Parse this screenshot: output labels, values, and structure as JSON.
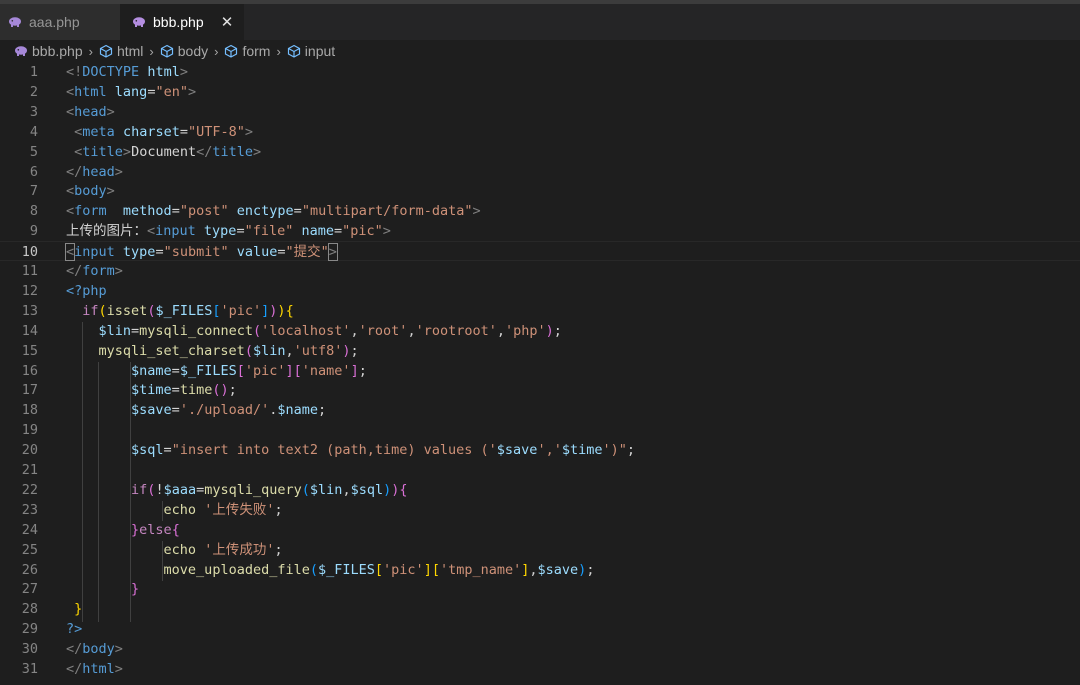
{
  "tabs": [
    {
      "label": "aaa.php",
      "active": false
    },
    {
      "label": "bbb.php",
      "active": true
    }
  ],
  "tab_close_glyph": "✕",
  "breadcrumb": {
    "file": "bbb.php",
    "items": [
      "html",
      "body",
      "form",
      "input"
    ],
    "separator": "›"
  },
  "editor": {
    "current_line": 10,
    "line_numbers": [
      "1",
      "2",
      "3",
      "4",
      "5",
      "6",
      "7",
      "8",
      "9",
      "10",
      "11",
      "12",
      "13",
      "14",
      "15",
      "16",
      "17",
      "18",
      "19",
      "20",
      "21",
      "22",
      "23",
      "24",
      "25",
      "26",
      "27",
      "28",
      "29",
      "30",
      "31"
    ],
    "lines": [
      [
        [
          "t-tag",
          "<!"
        ],
        [
          "t-doct",
          "DOCTYPE"
        ],
        [
          "t-text",
          " "
        ],
        [
          "t-attr",
          "html"
        ],
        [
          "t-tag",
          ">"
        ]
      ],
      [
        [
          "t-tag",
          "<"
        ],
        [
          "t-name",
          "html"
        ],
        [
          "t-text",
          " "
        ],
        [
          "t-attr",
          "lang"
        ],
        [
          "t-text",
          "="
        ],
        [
          "t-str",
          "\"en\""
        ],
        [
          "t-tag",
          ">"
        ]
      ],
      [
        [
          "t-tag",
          "<"
        ],
        [
          "t-name",
          "head"
        ],
        [
          "t-tag",
          ">"
        ]
      ],
      [
        [
          "t-text",
          " "
        ],
        [
          "t-tag",
          "<"
        ],
        [
          "t-name",
          "meta"
        ],
        [
          "t-text",
          " "
        ],
        [
          "t-attr",
          "charset"
        ],
        [
          "t-text",
          "="
        ],
        [
          "t-str",
          "\"UTF-8\""
        ],
        [
          "t-tag",
          ">"
        ]
      ],
      [
        [
          "t-text",
          " "
        ],
        [
          "t-tag",
          "<"
        ],
        [
          "t-name",
          "title"
        ],
        [
          "t-tag",
          ">"
        ],
        [
          "t-text",
          "Document"
        ],
        [
          "t-tag",
          "</"
        ],
        [
          "t-name",
          "title"
        ],
        [
          "t-tag",
          ">"
        ]
      ],
      [
        [
          "t-tag",
          "</"
        ],
        [
          "t-name",
          "head"
        ],
        [
          "t-tag",
          ">"
        ]
      ],
      [
        [
          "t-tag",
          "<"
        ],
        [
          "t-name",
          "body"
        ],
        [
          "t-tag",
          ">"
        ]
      ],
      [
        [
          "t-tag",
          "<"
        ],
        [
          "t-name",
          "form"
        ],
        [
          "t-text",
          "  "
        ],
        [
          "t-attr",
          "method"
        ],
        [
          "t-text",
          "="
        ],
        [
          "t-str",
          "\"post\""
        ],
        [
          "t-text",
          " "
        ],
        [
          "t-attr",
          "enctype"
        ],
        [
          "t-text",
          "="
        ],
        [
          "t-str",
          "\"multipart/form-data\""
        ],
        [
          "t-tag",
          ">"
        ]
      ],
      [
        [
          "t-text",
          "上传的图片："
        ],
        [
          "t-tag",
          "<"
        ],
        [
          "t-name",
          "input"
        ],
        [
          "t-text",
          " "
        ],
        [
          "t-attr",
          "type"
        ],
        [
          "t-text",
          "="
        ],
        [
          "t-str",
          "\"file\""
        ],
        [
          "t-text",
          " "
        ],
        [
          "t-attr",
          "name"
        ],
        [
          "t-text",
          "="
        ],
        [
          "t-str",
          "\"pic\""
        ],
        [
          "t-tag",
          ">"
        ]
      ],
      [
        [
          "t-tag cursor-box",
          "<"
        ],
        [
          "t-name",
          "input"
        ],
        [
          "t-text",
          " "
        ],
        [
          "t-attr",
          "type"
        ],
        [
          "t-text",
          "="
        ],
        [
          "t-str",
          "\"submit\""
        ],
        [
          "t-text",
          " "
        ],
        [
          "t-attr",
          "value"
        ],
        [
          "t-text",
          "="
        ],
        [
          "t-str",
          "\"提交\""
        ],
        [
          "t-tag cursor-box",
          ">"
        ]
      ],
      [
        [
          "t-tag",
          "</"
        ],
        [
          "t-name",
          "form"
        ],
        [
          "t-tag",
          ">"
        ]
      ],
      [
        [
          "t-php",
          "<?php"
        ]
      ],
      [
        [
          "t-text",
          "  "
        ],
        [
          "t-kw",
          "if"
        ],
        [
          "t-br1",
          "("
        ],
        [
          "t-fn",
          "isset"
        ],
        [
          "t-br2",
          "("
        ],
        [
          "t-var",
          "$_FILES"
        ],
        [
          "t-br3",
          "["
        ],
        [
          "t-str",
          "'pic'"
        ],
        [
          "t-br3",
          "]"
        ],
        [
          "t-br2",
          ")"
        ],
        [
          "t-br1",
          ")"
        ],
        [
          "t-br1",
          "{"
        ]
      ],
      [
        [
          "t-text",
          "    "
        ],
        [
          "t-var",
          "$lin"
        ],
        [
          "t-punc",
          "="
        ],
        [
          "t-fn",
          "mysqli_connect"
        ],
        [
          "t-br2",
          "("
        ],
        [
          "t-str",
          "'localhost'"
        ],
        [
          "t-punc",
          ","
        ],
        [
          "t-str",
          "'root'"
        ],
        [
          "t-punc",
          ","
        ],
        [
          "t-str",
          "'rootroot'"
        ],
        [
          "t-punc",
          ","
        ],
        [
          "t-str",
          "'php'"
        ],
        [
          "t-br2",
          ")"
        ],
        [
          "t-punc",
          ";"
        ]
      ],
      [
        [
          "t-text",
          "    "
        ],
        [
          "t-fn",
          "mysqli_set_charset"
        ],
        [
          "t-br2",
          "("
        ],
        [
          "t-var",
          "$lin"
        ],
        [
          "t-punc",
          ","
        ],
        [
          "t-str",
          "'utf8'"
        ],
        [
          "t-br2",
          ")"
        ],
        [
          "t-punc",
          ";"
        ]
      ],
      [
        [
          "t-text",
          "        "
        ],
        [
          "t-var",
          "$name"
        ],
        [
          "t-punc",
          "="
        ],
        [
          "t-var",
          "$_FILES"
        ],
        [
          "t-br2",
          "["
        ],
        [
          "t-str",
          "'pic'"
        ],
        [
          "t-br2",
          "]"
        ],
        [
          "t-br2",
          "["
        ],
        [
          "t-str",
          "'name'"
        ],
        [
          "t-br2",
          "]"
        ],
        [
          "t-punc",
          ";"
        ]
      ],
      [
        [
          "t-text",
          "        "
        ],
        [
          "t-var",
          "$time"
        ],
        [
          "t-punc",
          "="
        ],
        [
          "t-fn",
          "time"
        ],
        [
          "t-br2",
          "()"
        ],
        [
          "t-punc",
          ";"
        ]
      ],
      [
        [
          "t-text",
          "        "
        ],
        [
          "t-var",
          "$save"
        ],
        [
          "t-punc",
          "="
        ],
        [
          "t-str",
          "'./upload/'"
        ],
        [
          "t-punc",
          "."
        ],
        [
          "t-var",
          "$name"
        ],
        [
          "t-punc",
          ";"
        ]
      ],
      [],
      [
        [
          "t-text",
          "        "
        ],
        [
          "t-var",
          "$sql"
        ],
        [
          "t-punc",
          "="
        ],
        [
          "t-str",
          "\"insert into text2 (path,time) values ('"
        ],
        [
          "t-var",
          "$save"
        ],
        [
          "t-str",
          "','"
        ],
        [
          "t-var",
          "$time"
        ],
        [
          "t-str",
          "')\""
        ],
        [
          "t-punc",
          ";"
        ]
      ],
      [],
      [
        [
          "t-text",
          "        "
        ],
        [
          "t-kw",
          "if"
        ],
        [
          "t-br2",
          "("
        ],
        [
          "t-punc",
          "!"
        ],
        [
          "t-var",
          "$aaa"
        ],
        [
          "t-punc",
          "="
        ],
        [
          "t-fn",
          "mysqli_query"
        ],
        [
          "t-br3",
          "("
        ],
        [
          "t-var",
          "$lin"
        ],
        [
          "t-punc",
          ","
        ],
        [
          "t-var",
          "$sql"
        ],
        [
          "t-br3",
          ")"
        ],
        [
          "t-br2",
          ")"
        ],
        [
          "t-br2",
          "{"
        ]
      ],
      [
        [
          "t-text",
          "            "
        ],
        [
          "t-fn",
          "echo"
        ],
        [
          "t-text",
          " "
        ],
        [
          "t-str",
          "'上传失败'"
        ],
        [
          "t-punc",
          ";"
        ]
      ],
      [
        [
          "t-text",
          "        "
        ],
        [
          "t-br2",
          "}"
        ],
        [
          "t-kw",
          "else"
        ],
        [
          "t-br2",
          "{"
        ]
      ],
      [
        [
          "t-text",
          "            "
        ],
        [
          "t-fn",
          "echo"
        ],
        [
          "t-text",
          " "
        ],
        [
          "t-str",
          "'上传成功'"
        ],
        [
          "t-punc",
          ";"
        ]
      ],
      [
        [
          "t-text",
          "            "
        ],
        [
          "t-fn",
          "move_uploaded_file"
        ],
        [
          "t-br3",
          "("
        ],
        [
          "t-var",
          "$_FILES"
        ],
        [
          "t-br1",
          "["
        ],
        [
          "t-str",
          "'pic'"
        ],
        [
          "t-br1",
          "]"
        ],
        [
          "t-br1",
          "["
        ],
        [
          "t-str",
          "'tmp_name'"
        ],
        [
          "t-br1",
          "]"
        ],
        [
          "t-punc",
          ","
        ],
        [
          "t-var",
          "$save"
        ],
        [
          "t-br3",
          ")"
        ],
        [
          "t-punc",
          ";"
        ]
      ],
      [
        [
          "t-text",
          "        "
        ],
        [
          "t-br2",
          "}"
        ]
      ],
      [
        [
          "t-text",
          " "
        ],
        [
          "t-br1",
          "}"
        ]
      ],
      [
        [
          "t-php",
          "?>"
        ]
      ],
      [
        [
          "t-tag",
          "</"
        ],
        [
          "t-name",
          "body"
        ],
        [
          "t-tag",
          ">"
        ]
      ],
      [
        [
          "t-tag",
          "</"
        ],
        [
          "t-name",
          "html"
        ],
        [
          "t-tag",
          ">"
        ]
      ]
    ]
  },
  "colors": {
    "background": "#1e1e1e",
    "tab_bar": "#252526",
    "php_icon": "#b48ee0"
  }
}
